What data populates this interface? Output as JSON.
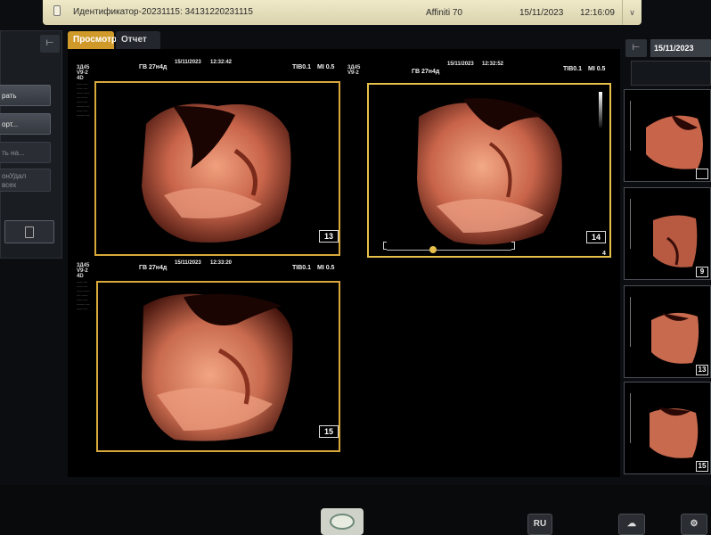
{
  "topbar": {
    "patient_id": "Идентификатор-20231115:  34131220231115",
    "model": "Affiniti 70",
    "date": "15/11/2023",
    "time": "12:16:09"
  },
  "left_panel": {
    "buttons": [
      "рать",
      "орт...",
      "ть на...",
      "онУдал\nвсех"
    ]
  },
  "tabs": [
    "Просмотр",
    "Отчет"
  ],
  "panes": [
    {
      "mode": "3Д45",
      "probe": "V9-2",
      "dim": "4D",
      "ga": "ГВ 27н4д",
      "date": "15/11/2023",
      "time": "12:32:42",
      "tib": "TIB0.1",
      "mi": "MI 0.5",
      "image_no": "13"
    },
    {
      "mode": "3Д45",
      "probe": "V9-2",
      "ga": "ГВ 27н4д",
      "date": "15/11/2023",
      "time": "12:32:52",
      "tib": "TIB0.1",
      "mi": "MI 0.5",
      "image_no": "14",
      "corner": "4"
    },
    {
      "mode": "3Д45",
      "probe": "V9-2",
      "dim": "4D",
      "ga": "ГВ 27н4д",
      "date": "15/11/2023",
      "time": "12:33:20",
      "tib": "TIB0.1",
      "mi": "MI 0.5",
      "image_no": "15"
    }
  ],
  "right_panel": {
    "date": "15/11/2023",
    "thumbnails": [
      "",
      "9",
      "13",
      "15"
    ]
  },
  "bottom": {
    "language": "RU"
  },
  "colors": {
    "accent": "#d09a2b",
    "frame": "#d8a93a",
    "render_tone": "#c8644a"
  }
}
